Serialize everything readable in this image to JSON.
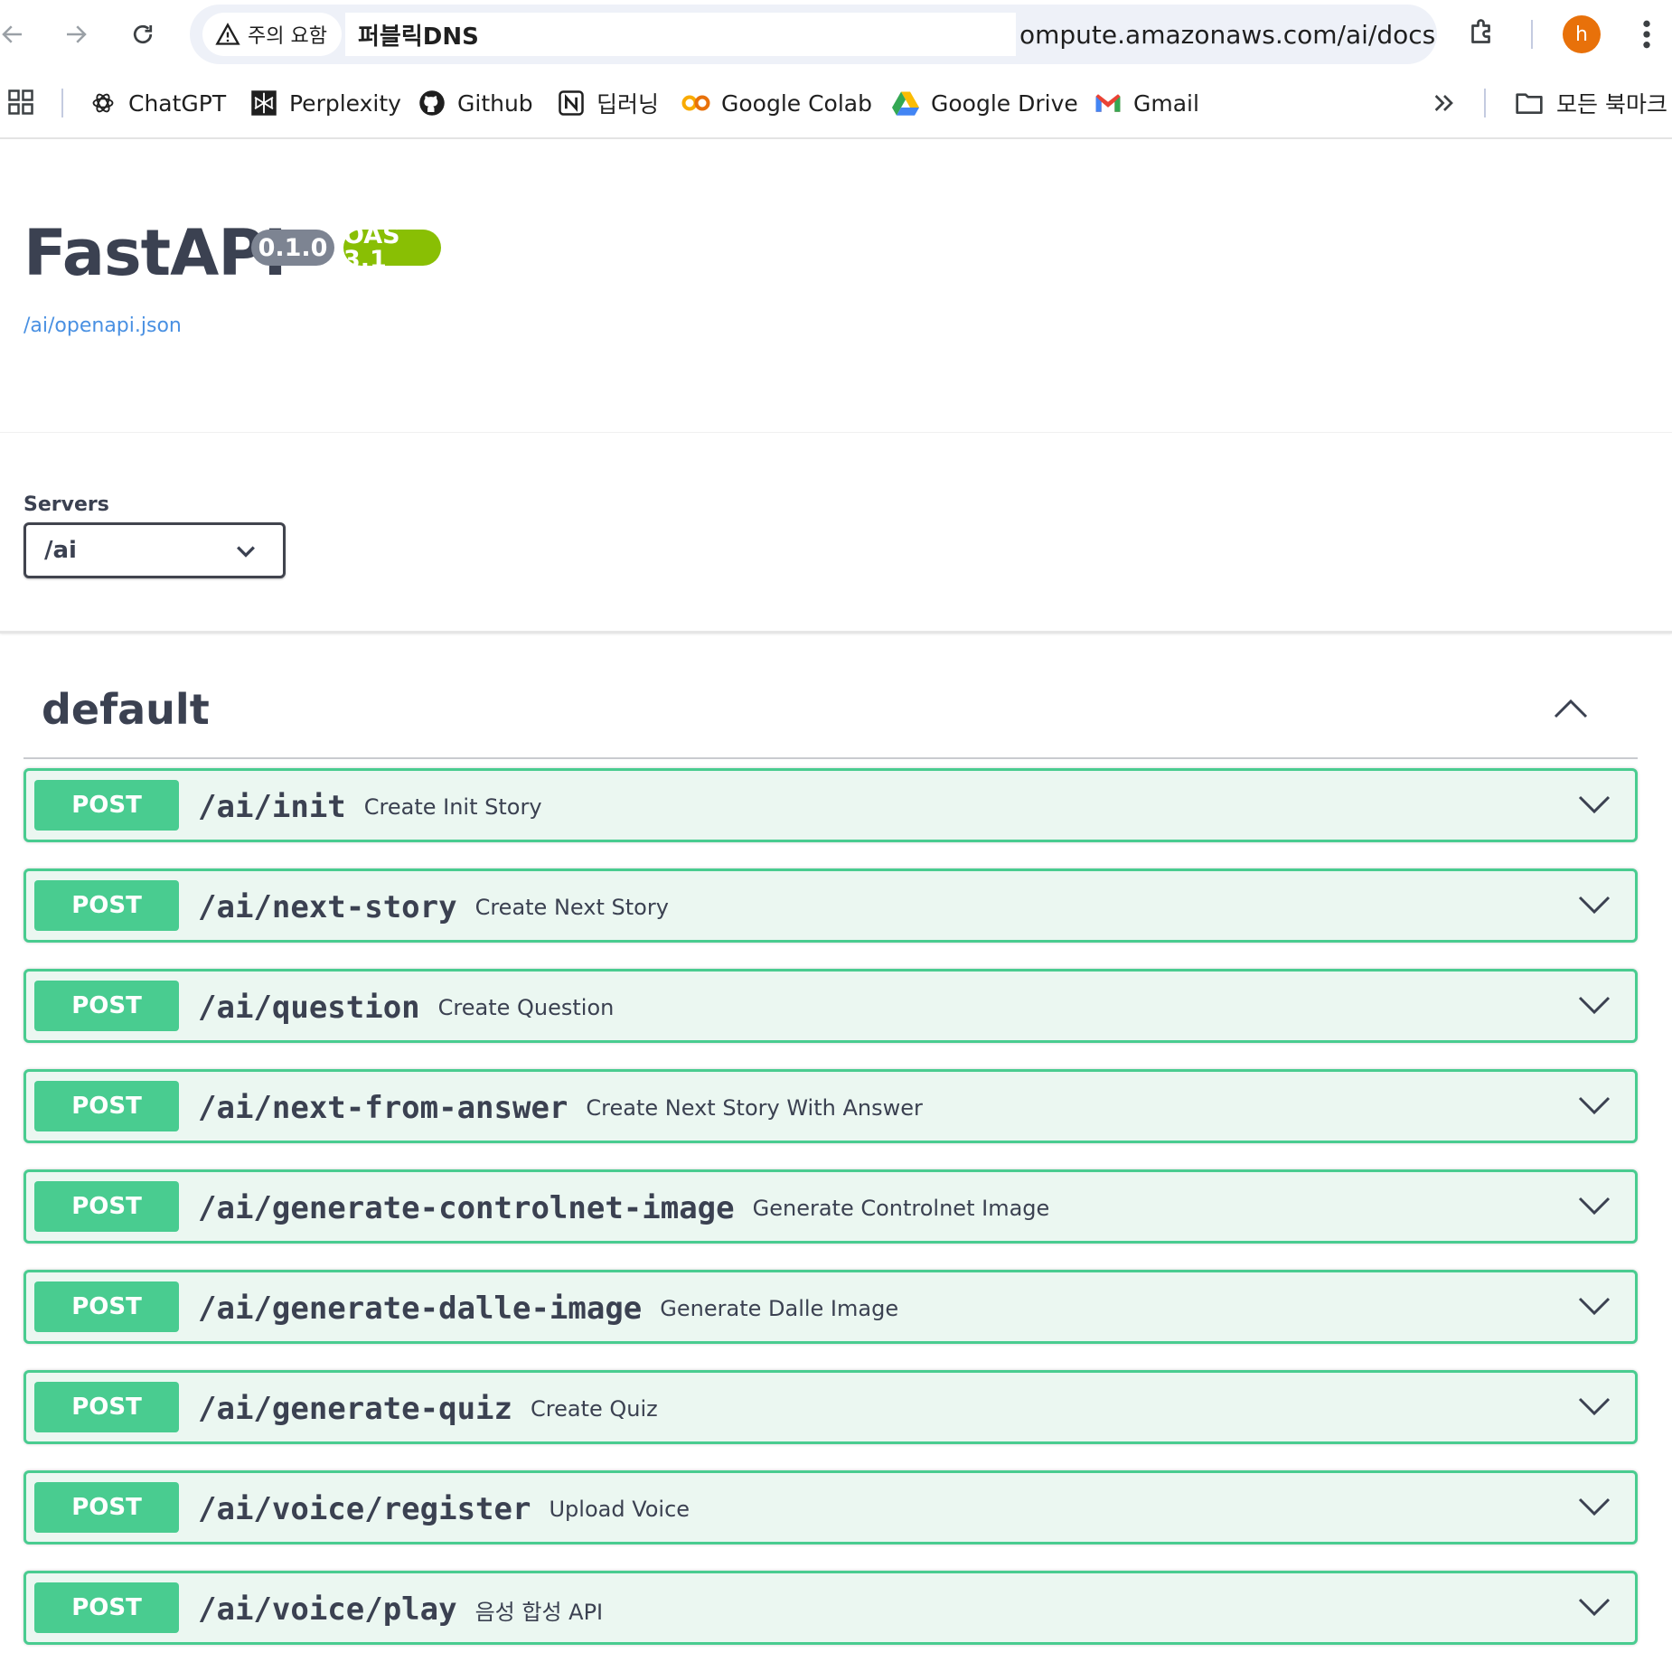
{
  "browser": {
    "security_chip": "주의 요함",
    "url_host": "퍼블릭DNS",
    "url_rest": "ompute.amazonaws.com/ai/docs",
    "avatar_letter": "h",
    "avatar_color": "#e8710a"
  },
  "bookmarks": {
    "items": [
      {
        "label": "ChatGPT",
        "icon": "chatgpt-icon"
      },
      {
        "label": "Perplexity",
        "icon": "perplexity-icon"
      },
      {
        "label": "Github",
        "icon": "github-icon"
      },
      {
        "label": "딥러닝",
        "icon": "notion-icon"
      },
      {
        "label": "Google Colab",
        "icon": "colab-icon"
      },
      {
        "label": "Google Drive",
        "icon": "drive-icon"
      },
      {
        "label": "Gmail",
        "icon": "gmail-icon"
      }
    ],
    "all_bookmarks": "모든 북마크"
  },
  "info": {
    "title": "FastAPI",
    "version": "0.1.0",
    "oas": "OAS 3.1",
    "spec_link": "/ai/openapi.json"
  },
  "servers": {
    "label": "Servers",
    "selected": "/ai"
  },
  "tag": {
    "name": "default"
  },
  "colors": {
    "post": "#49cc90",
    "post_bg": "#ebf7f1",
    "link": "#4990e2",
    "badge_version": "#7d8492",
    "badge_oas": "#89bf04"
  },
  "operations": [
    {
      "method": "POST",
      "path": "/ai/init",
      "summary": "Create Init Story"
    },
    {
      "method": "POST",
      "path": "/ai/next-story",
      "summary": "Create Next Story"
    },
    {
      "method": "POST",
      "path": "/ai/question",
      "summary": "Create Question"
    },
    {
      "method": "POST",
      "path": "/ai/next-from-answer",
      "summary": "Create Next Story With Answer"
    },
    {
      "method": "POST",
      "path": "/ai/generate-controlnet-image",
      "summary": "Generate Controlnet Image"
    },
    {
      "method": "POST",
      "path": "/ai/generate-dalle-image",
      "summary": "Generate Dalle Image"
    },
    {
      "method": "POST",
      "path": "/ai/generate-quiz",
      "summary": "Create Quiz"
    },
    {
      "method": "POST",
      "path": "/ai/voice/register",
      "summary": "Upload Voice"
    },
    {
      "method": "POST",
      "path": "/ai/voice/play",
      "summary": "음성 합성 API"
    }
  ]
}
